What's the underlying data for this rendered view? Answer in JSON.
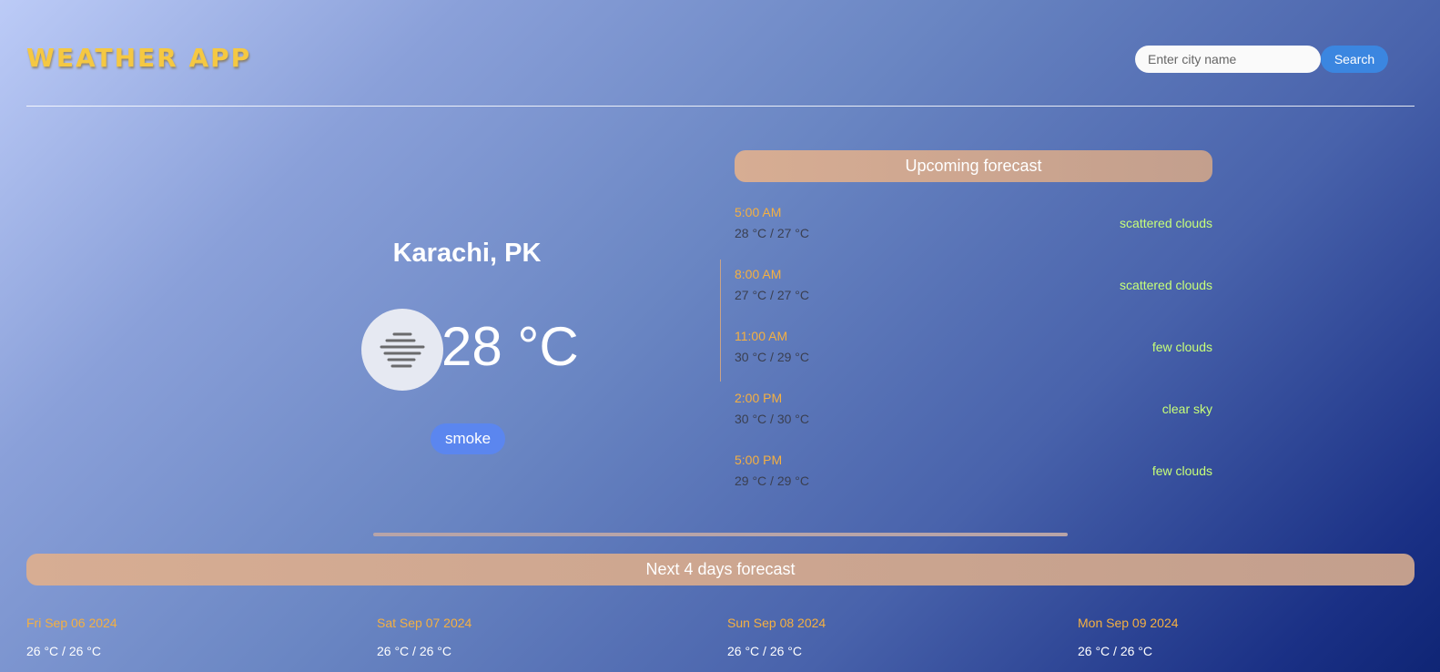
{
  "header": {
    "logo": "WEATHER APP",
    "search": {
      "placeholder": "Enter city name",
      "value": ""
    },
    "search_button": "Search"
  },
  "current": {
    "city": "Karachi, PK",
    "temperature": "28 °C",
    "condition": "smoke",
    "icon": "mist-icon"
  },
  "upcoming": {
    "title": "Upcoming forecast",
    "items": [
      {
        "time": "5:00 AM",
        "temp": "28 °C / 27 °C",
        "desc": "scattered clouds"
      },
      {
        "time": "8:00 AM",
        "temp": "27 °C / 27 °C",
        "desc": "scattered clouds"
      },
      {
        "time": "11:00 AM",
        "temp": "30 °C / 29 °C",
        "desc": "few clouds"
      },
      {
        "time": "2:00 PM",
        "temp": "30 °C / 30 °C",
        "desc": "clear sky"
      },
      {
        "time": "5:00 PM",
        "temp": "29 °C / 29 °C",
        "desc": "few clouds"
      }
    ]
  },
  "daily": {
    "title": "Next 4 days forecast",
    "days": [
      {
        "date": "Fri Sep 06 2024",
        "temp": "26 °C / 26 °C"
      },
      {
        "date": "Sat Sep 07 2024",
        "temp": "26 °C / 26 °C"
      },
      {
        "date": "Sun Sep 08 2024",
        "temp": "26 °C / 26 °C"
      },
      {
        "date": "Mon Sep 09 2024",
        "temp": "26 °C / 26 °C"
      }
    ]
  },
  "colors": {
    "logo": "#f5c842",
    "accent_button": "#3b86e0",
    "condition_badge": "#5b86ef",
    "banner": "#d7ad93",
    "time_text": "#f5b041",
    "desc_text": "#c7ff78"
  }
}
